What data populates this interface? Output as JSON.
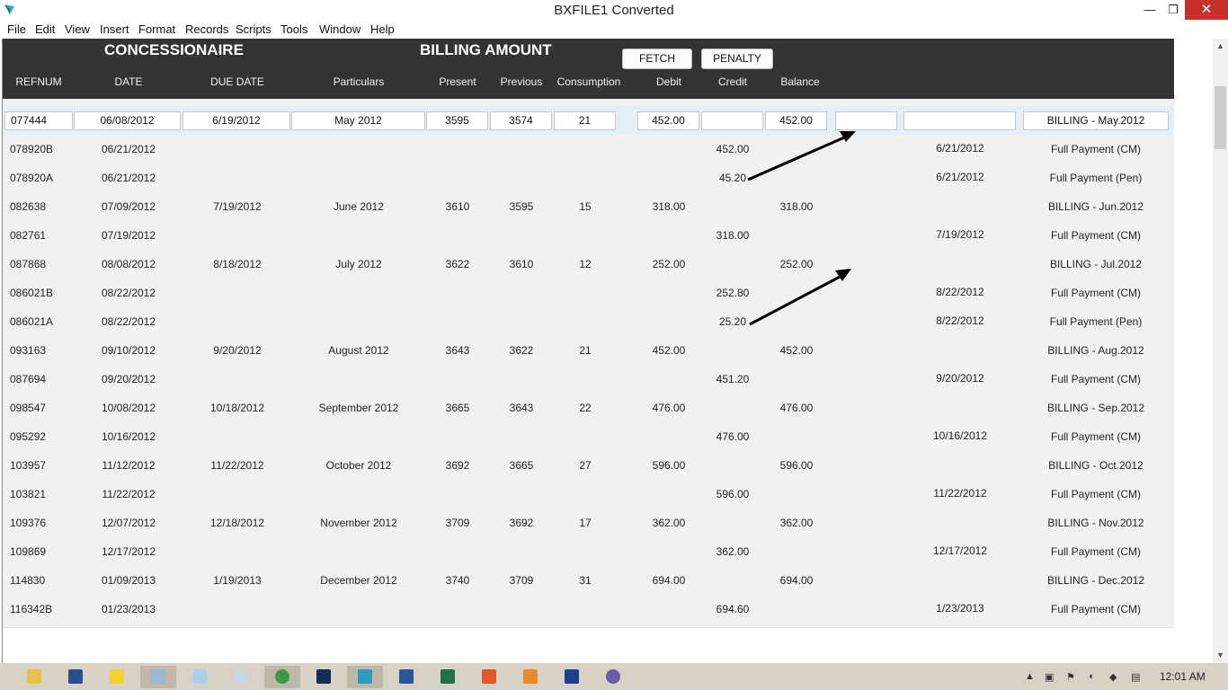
{
  "window": {
    "title": "BXFILE1 Converted",
    "min_glyph": "—",
    "max_glyph": "❐",
    "close_glyph": "✕"
  },
  "menu": [
    "File",
    "Edit",
    "View",
    "Insert",
    "Format",
    "Records",
    "Scripts",
    "Tools",
    "Window",
    "Help"
  ],
  "header": {
    "concessionaire": "CONCESSIONAIRE",
    "billing_amount": "BILLING AMOUNT",
    "fetch_label": "FETCH",
    "penalty_label": "PENALTY",
    "columns": [
      "REFNUM",
      "DATE",
      "DUE DATE",
      "Particulars",
      "Present",
      "Previous",
      "Consumption",
      "Debit",
      "Credit",
      "Balance"
    ]
  },
  "active_row": {
    "refnum": "077444",
    "date": "06/08/2012",
    "due_date": "6/19/2012",
    "particulars": "May 2012",
    "present": "3595",
    "previous": "3574",
    "consumption": "21",
    "debit": "452.00",
    "credit": "",
    "balance": "452.00",
    "extra1": "",
    "extra2": "",
    "description": "BILLING - May.2012"
  },
  "rows": [
    [
      "078920B",
      "06/21/2012",
      "",
      "",
      "",
      "",
      "",
      "",
      "452.00",
      "",
      "6/21/2012",
      "Full Payment (CM)"
    ],
    [
      "078920A",
      "06/21/2012",
      "",
      "",
      "",
      "",
      "",
      "",
      "45.20",
      "",
      "6/21/2012",
      "Full Payment (Pen)"
    ],
    [
      "082638",
      "07/09/2012",
      "7/19/2012",
      "June 2012",
      "3610",
      "3595",
      "15",
      "318.00",
      "",
      "318.00",
      "",
      "BILLING - Jun.2012"
    ],
    [
      "082761",
      "07/19/2012",
      "",
      "",
      "",
      "",
      "",
      "",
      "318.00",
      "",
      "7/19/2012",
      "Full Payment (CM)"
    ],
    [
      "087868",
      "08/08/2012",
      "8/18/2012",
      "July 2012",
      "3622",
      "3610",
      "12",
      "252.00",
      "",
      "252.00",
      "",
      "BILLING - Jul.2012"
    ],
    [
      "086021B",
      "08/22/2012",
      "",
      "",
      "",
      "",
      "",
      "",
      "252.80",
      "",
      "8/22/2012",
      "Full Payment (CM)"
    ],
    [
      "086021A",
      "08/22/2012",
      "",
      "",
      "",
      "",
      "",
      "",
      "25.20",
      "",
      "8/22/2012",
      "Full Payment (Pen)"
    ],
    [
      "093163",
      "09/10/2012",
      "9/20/2012",
      "August 2012",
      "3643",
      "3622",
      "21",
      "452.00",
      "",
      "452.00",
      "",
      "BILLING - Aug.2012"
    ],
    [
      "087694",
      "09/20/2012",
      "",
      "",
      "",
      "",
      "",
      "",
      "451.20",
      "",
      "9/20/2012",
      "Full Payment (CM)"
    ],
    [
      "098547",
      "10/08/2012",
      "10/18/2012",
      "September 2012",
      "3665",
      "3643",
      "22",
      "476.00",
      "",
      "476.00",
      "",
      "BILLING - Sep.2012"
    ],
    [
      "095292",
      "10/16/2012",
      "",
      "",
      "",
      "",
      "",
      "",
      "476.00",
      "",
      "10/16/2012",
      "Full Payment (CM)"
    ],
    [
      "103957",
      "11/12/2012",
      "11/22/2012",
      "October 2012",
      "3692",
      "3665",
      "27",
      "596.00",
      "",
      "596.00",
      "",
      "BILLING - Oct.2012"
    ],
    [
      "103821",
      "11/22/2012",
      "",
      "",
      "",
      "",
      "",
      "",
      "596.00",
      "",
      "11/22/2012",
      "Full Payment (CM)"
    ],
    [
      "109376",
      "12/07/2012",
      "12/18/2012",
      "November 2012",
      "3709",
      "3692",
      "17",
      "362.00",
      "",
      "362.00",
      "",
      "BILLING - Nov.2012"
    ],
    [
      "109869",
      "12/17/2012",
      "",
      "",
      "",
      "",
      "",
      "",
      "362.00",
      "",
      "12/17/2012",
      "Full Payment (CM)"
    ],
    [
      "114830",
      "01/09/2013",
      "1/19/2013",
      "December 2012",
      "3740",
      "3709",
      "31",
      "694.00",
      "",
      "694.00",
      "",
      "BILLING - Dec.2012"
    ],
    [
      "116342B",
      "01/23/2013",
      "",
      "",
      "",
      "",
      "",
      "",
      "694.60",
      "",
      "1/23/2013",
      "Full Payment (CM)"
    ]
  ],
  "taskbar": {
    "icons": [
      "file-explorer-icon",
      "app-icon",
      "pencil-icon",
      "app-icon",
      "notepad-icon",
      "calculator-icon",
      "chrome-icon",
      "photoshop-icon",
      "bxfile-icon",
      "word-icon",
      "excel-icon",
      "app-icon",
      "app-icon",
      "app-icon",
      "app-icon"
    ],
    "clock": "12:01 AM"
  }
}
